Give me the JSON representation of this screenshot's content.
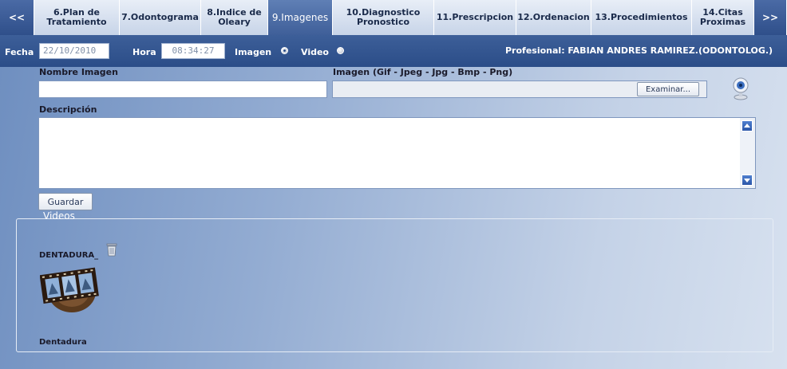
{
  "tabs": {
    "prev_label": "<<",
    "next_label": ">>",
    "items": [
      {
        "label": "6.Plan de\nTratamiento"
      },
      {
        "label": "7.Odontograma"
      },
      {
        "label": "8.Indice de\nOleary"
      },
      {
        "label": "9.Imagenes"
      },
      {
        "label": "10.Diagnostico\nPronostico"
      },
      {
        "label": "11.Prescripcion"
      },
      {
        "label": "12.Ordenacion"
      },
      {
        "label": "13.Procedimientos"
      },
      {
        "label": "14.Citas\nProximas"
      }
    ],
    "active_index": 3
  },
  "infobar": {
    "fecha_label": "Fecha",
    "fecha_value": "22/10/2010",
    "hora_label": "Hora",
    "hora_value": "08:34:27",
    "imagen_label": "Imagen",
    "video_label": "Video",
    "profesional": "Profesional: FABIAN ANDRES RAMIREZ.(ODONTOLOG.)"
  },
  "form": {
    "nombre_label": "Nombre Imagen",
    "nombre_value": "",
    "imagen_label": "Imagen (Gif - Jpeg - Jpg - Bmp - Png)",
    "imagen_value": "",
    "examinar_label": "Examinar...",
    "descripcion_label": "Descripción",
    "descripcion_value": "",
    "guardar_label": "Guardar"
  },
  "videos": {
    "legend": "Videos",
    "items": [
      {
        "title": "DENTADURA_",
        "caption": "Dentadura"
      }
    ]
  },
  "colors": {
    "active_tab": "#4a6aa5",
    "infobar": "#2b4d88",
    "accent": "#2a56a8"
  }
}
